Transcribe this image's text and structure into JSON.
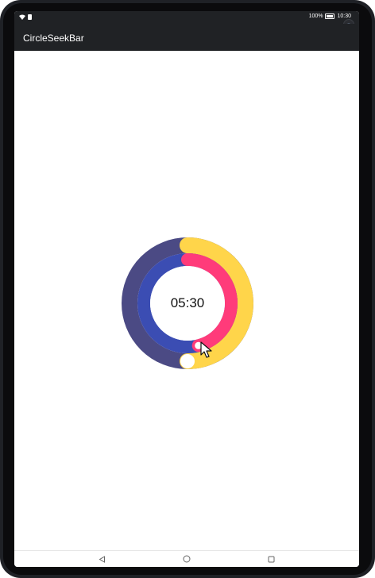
{
  "status_bar": {
    "battery_text": "100%",
    "time": "10:30"
  },
  "app_bar": {
    "title": "CircleSeekBar"
  },
  "seekbar": {
    "time_label": "05:30",
    "hours_progress": 0.5,
    "minutes_progress": 0.46,
    "colors": {
      "outer_track": "#4b4a84",
      "outer_progress": "#ffd54a",
      "inner_track": "#3b4db3",
      "inner_progress": "#ff3b7a",
      "center": "#ffffff",
      "outer_thumb": "#ffffff",
      "inner_thumb": "#ff3b7a"
    }
  },
  "nav_bar": {
    "back_icon": "back-triangle-icon",
    "home_icon": "home-circle-icon",
    "recents_icon": "recents-square-icon"
  }
}
